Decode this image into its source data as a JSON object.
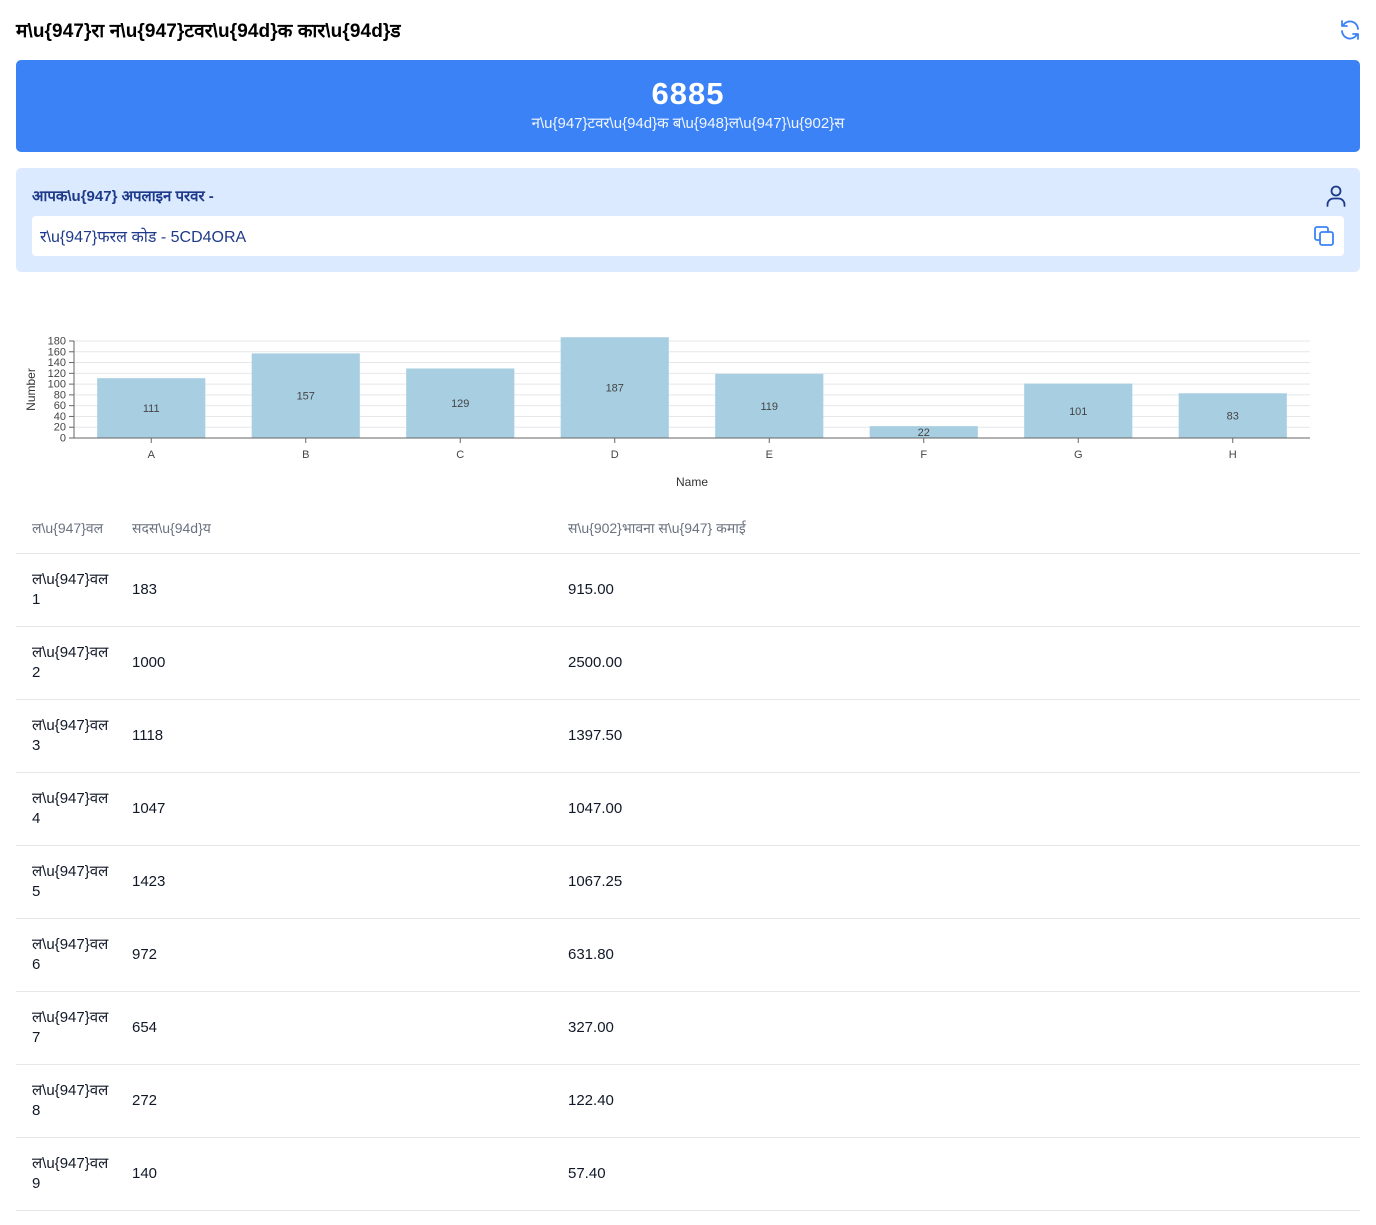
{
  "header": {
    "title": "म\\u{947}रा न\\u{947}टवर\\u{94d}क कार\\u{94d}ड"
  },
  "stat": {
    "value": "6885",
    "label": "न\\u{947}टवर\\u{94d}क ब\\u{948}ल\\u{947}\\u{902}स"
  },
  "referral": {
    "title": "आपक\\u{947} अपलाइन परवर -",
    "code_text": "र\\u{947}फरल कोड - 5CD4ORA"
  },
  "icons": {
    "refresh": "refresh-icon",
    "user": "user-icon",
    "copy": "copy-icon"
  },
  "colors": {
    "primary": "#3b82f6",
    "card_bg": "#dbeafe",
    "title_blue": "#1e3a8a",
    "bar_fill": "#a8cee2"
  },
  "chart_data": {
    "type": "bar",
    "categories": [
      "A",
      "B",
      "C",
      "D",
      "E",
      "F",
      "G",
      "H"
    ],
    "values": [
      111,
      157,
      129,
      187,
      119,
      22,
      101,
      83
    ],
    "xlabel": "Name",
    "ylabel": "Number",
    "ylim": [
      0,
      180
    ],
    "yticks": [
      0,
      20,
      40,
      60,
      80,
      100,
      120,
      140,
      160,
      180
    ],
    "grid": true,
    "data_labels": true
  },
  "table": {
    "headers": [
      "ल\\u{947}वल",
      "सदस\\u{94d}य",
      "स\\u{902}भावना स\\u{947} कमाई"
    ],
    "rows": [
      [
        "ल\\u{947}वल 1",
        "183",
        "915.00"
      ],
      [
        "ल\\u{947}वल 2",
        "1000",
        "2500.00"
      ],
      [
        "ल\\u{947}वल 3",
        "1118",
        "1397.50"
      ],
      [
        "ल\\u{947}वल 4",
        "1047",
        "1047.00"
      ],
      [
        "ल\\u{947}वल 5",
        "1423",
        "1067.25"
      ],
      [
        "ल\\u{947}वल 6",
        "972",
        "631.80"
      ],
      [
        "ल\\u{947}वल 7",
        "654",
        "327.00"
      ],
      [
        "ल\\u{947}वल 8",
        "272",
        "122.40"
      ],
      [
        "ल\\u{947}वल 9",
        "140",
        "57.40"
      ]
    ]
  }
}
